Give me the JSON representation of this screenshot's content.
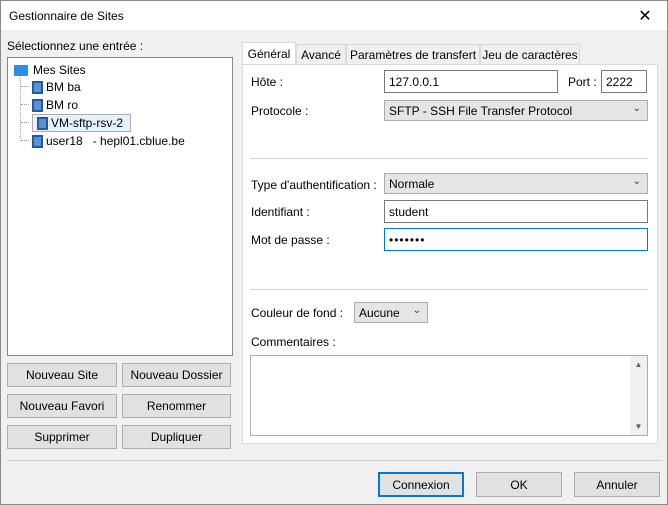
{
  "window": {
    "title": "Gestionnaire de Sites"
  },
  "left": {
    "select_label": "Sélectionnez une entrée :",
    "tree_root": "Mes Sites",
    "tree_items": [
      "BM ba",
      "BM ro",
      "VM-sftp-rsv-2",
      "user18   - hepl01.cblue.be"
    ],
    "selected_index": 2
  },
  "buttons": {
    "new_site": "Nouveau Site",
    "new_folder": "Nouveau Dossier",
    "new_favorite": "Nouveau Favori",
    "rename": "Renommer",
    "delete": "Supprimer",
    "duplicate": "Dupliquer",
    "connect": "Connexion",
    "ok": "OK",
    "cancel": "Annuler"
  },
  "tabs": [
    "Général",
    "Avancé",
    "Paramètres de transfert",
    "Jeu de caractères"
  ],
  "general": {
    "host_label": "Hôte :",
    "host_value": "127.0.0.1",
    "port_label": "Port :",
    "port_value": "2222",
    "protocol_label": "Protocole :",
    "protocol_value": "SFTP - SSH File Transfer Protocol",
    "auth_label": "Type d'authentification :",
    "auth_value": "Normale",
    "user_label": "Identifiant :",
    "user_value": "student",
    "password_label": "Mot de passe :",
    "password_value": "•••••••",
    "bg_color_label": "Couleur de fond :",
    "bg_color_value": "Aucune",
    "comments_label": "Commentaires :"
  },
  "colors": {
    "accent": "#0078d7",
    "folder": "#2b8ee0",
    "selection": "#e5f3ff"
  }
}
